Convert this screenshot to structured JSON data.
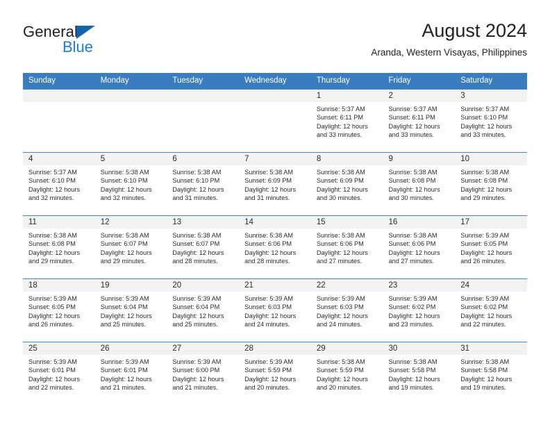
{
  "brand": {
    "name_part1": "General",
    "name_part2": "Blue",
    "triangle_color": "#1464aa",
    "blue_color": "#1a7fd4"
  },
  "header": {
    "title": "August 2024",
    "subtitle": "Aranda, Western Visayas, Philippines",
    "header_bg_color": "#3a7cc0",
    "row_band_color": "#f2f2f2"
  },
  "weekday_headers": [
    "Sunday",
    "Monday",
    "Tuesday",
    "Wednesday",
    "Thursday",
    "Friday",
    "Saturday"
  ],
  "weeks": [
    [
      {
        "day": "",
        "sunrise": "",
        "sunset": "",
        "daylight1": "",
        "daylight2": ""
      },
      {
        "day": "",
        "sunrise": "",
        "sunset": "",
        "daylight1": "",
        "daylight2": ""
      },
      {
        "day": "",
        "sunrise": "",
        "sunset": "",
        "daylight1": "",
        "daylight2": ""
      },
      {
        "day": "",
        "sunrise": "",
        "sunset": "",
        "daylight1": "",
        "daylight2": ""
      },
      {
        "day": "1",
        "sunrise": "Sunrise: 5:37 AM",
        "sunset": "Sunset: 6:11 PM",
        "daylight1": "Daylight: 12 hours",
        "daylight2": "and 33 minutes."
      },
      {
        "day": "2",
        "sunrise": "Sunrise: 5:37 AM",
        "sunset": "Sunset: 6:11 PM",
        "daylight1": "Daylight: 12 hours",
        "daylight2": "and 33 minutes."
      },
      {
        "day": "3",
        "sunrise": "Sunrise: 5:37 AM",
        "sunset": "Sunset: 6:10 PM",
        "daylight1": "Daylight: 12 hours",
        "daylight2": "and 33 minutes."
      }
    ],
    [
      {
        "day": "4",
        "sunrise": "Sunrise: 5:37 AM",
        "sunset": "Sunset: 6:10 PM",
        "daylight1": "Daylight: 12 hours",
        "daylight2": "and 32 minutes."
      },
      {
        "day": "5",
        "sunrise": "Sunrise: 5:38 AM",
        "sunset": "Sunset: 6:10 PM",
        "daylight1": "Daylight: 12 hours",
        "daylight2": "and 32 minutes."
      },
      {
        "day": "6",
        "sunrise": "Sunrise: 5:38 AM",
        "sunset": "Sunset: 6:10 PM",
        "daylight1": "Daylight: 12 hours",
        "daylight2": "and 31 minutes."
      },
      {
        "day": "7",
        "sunrise": "Sunrise: 5:38 AM",
        "sunset": "Sunset: 6:09 PM",
        "daylight1": "Daylight: 12 hours",
        "daylight2": "and 31 minutes."
      },
      {
        "day": "8",
        "sunrise": "Sunrise: 5:38 AM",
        "sunset": "Sunset: 6:09 PM",
        "daylight1": "Daylight: 12 hours",
        "daylight2": "and 30 minutes."
      },
      {
        "day": "9",
        "sunrise": "Sunrise: 5:38 AM",
        "sunset": "Sunset: 6:08 PM",
        "daylight1": "Daylight: 12 hours",
        "daylight2": "and 30 minutes."
      },
      {
        "day": "10",
        "sunrise": "Sunrise: 5:38 AM",
        "sunset": "Sunset: 6:08 PM",
        "daylight1": "Daylight: 12 hours",
        "daylight2": "and 29 minutes."
      }
    ],
    [
      {
        "day": "11",
        "sunrise": "Sunrise: 5:38 AM",
        "sunset": "Sunset: 6:08 PM",
        "daylight1": "Daylight: 12 hours",
        "daylight2": "and 29 minutes."
      },
      {
        "day": "12",
        "sunrise": "Sunrise: 5:38 AM",
        "sunset": "Sunset: 6:07 PM",
        "daylight1": "Daylight: 12 hours",
        "daylight2": "and 29 minutes."
      },
      {
        "day": "13",
        "sunrise": "Sunrise: 5:38 AM",
        "sunset": "Sunset: 6:07 PM",
        "daylight1": "Daylight: 12 hours",
        "daylight2": "and 28 minutes."
      },
      {
        "day": "14",
        "sunrise": "Sunrise: 5:38 AM",
        "sunset": "Sunset: 6:06 PM",
        "daylight1": "Daylight: 12 hours",
        "daylight2": "and 28 minutes."
      },
      {
        "day": "15",
        "sunrise": "Sunrise: 5:38 AM",
        "sunset": "Sunset: 6:06 PM",
        "daylight1": "Daylight: 12 hours",
        "daylight2": "and 27 minutes."
      },
      {
        "day": "16",
        "sunrise": "Sunrise: 5:38 AM",
        "sunset": "Sunset: 6:06 PM",
        "daylight1": "Daylight: 12 hours",
        "daylight2": "and 27 minutes."
      },
      {
        "day": "17",
        "sunrise": "Sunrise: 5:39 AM",
        "sunset": "Sunset: 6:05 PM",
        "daylight1": "Daylight: 12 hours",
        "daylight2": "and 26 minutes."
      }
    ],
    [
      {
        "day": "18",
        "sunrise": "Sunrise: 5:39 AM",
        "sunset": "Sunset: 6:05 PM",
        "daylight1": "Daylight: 12 hours",
        "daylight2": "and 26 minutes."
      },
      {
        "day": "19",
        "sunrise": "Sunrise: 5:39 AM",
        "sunset": "Sunset: 6:04 PM",
        "daylight1": "Daylight: 12 hours",
        "daylight2": "and 25 minutes."
      },
      {
        "day": "20",
        "sunrise": "Sunrise: 5:39 AM",
        "sunset": "Sunset: 6:04 PM",
        "daylight1": "Daylight: 12 hours",
        "daylight2": "and 25 minutes."
      },
      {
        "day": "21",
        "sunrise": "Sunrise: 5:39 AM",
        "sunset": "Sunset: 6:03 PM",
        "daylight1": "Daylight: 12 hours",
        "daylight2": "and 24 minutes."
      },
      {
        "day": "22",
        "sunrise": "Sunrise: 5:39 AM",
        "sunset": "Sunset: 6:03 PM",
        "daylight1": "Daylight: 12 hours",
        "daylight2": "and 24 minutes."
      },
      {
        "day": "23",
        "sunrise": "Sunrise: 5:39 AM",
        "sunset": "Sunset: 6:02 PM",
        "daylight1": "Daylight: 12 hours",
        "daylight2": "and 23 minutes."
      },
      {
        "day": "24",
        "sunrise": "Sunrise: 5:39 AM",
        "sunset": "Sunset: 6:02 PM",
        "daylight1": "Daylight: 12 hours",
        "daylight2": "and 22 minutes."
      }
    ],
    [
      {
        "day": "25",
        "sunrise": "Sunrise: 5:39 AM",
        "sunset": "Sunset: 6:01 PM",
        "daylight1": "Daylight: 12 hours",
        "daylight2": "and 22 minutes."
      },
      {
        "day": "26",
        "sunrise": "Sunrise: 5:39 AM",
        "sunset": "Sunset: 6:01 PM",
        "daylight1": "Daylight: 12 hours",
        "daylight2": "and 21 minutes."
      },
      {
        "day": "27",
        "sunrise": "Sunrise: 5:39 AM",
        "sunset": "Sunset: 6:00 PM",
        "daylight1": "Daylight: 12 hours",
        "daylight2": "and 21 minutes."
      },
      {
        "day": "28",
        "sunrise": "Sunrise: 5:39 AM",
        "sunset": "Sunset: 5:59 PM",
        "daylight1": "Daylight: 12 hours",
        "daylight2": "and 20 minutes."
      },
      {
        "day": "29",
        "sunrise": "Sunrise: 5:38 AM",
        "sunset": "Sunset: 5:59 PM",
        "daylight1": "Daylight: 12 hours",
        "daylight2": "and 20 minutes."
      },
      {
        "day": "30",
        "sunrise": "Sunrise: 5:38 AM",
        "sunset": "Sunset: 5:58 PM",
        "daylight1": "Daylight: 12 hours",
        "daylight2": "and 19 minutes."
      },
      {
        "day": "31",
        "sunrise": "Sunrise: 5:38 AM",
        "sunset": "Sunset: 5:58 PM",
        "daylight1": "Daylight: 12 hours",
        "daylight2": "and 19 minutes."
      }
    ]
  ]
}
